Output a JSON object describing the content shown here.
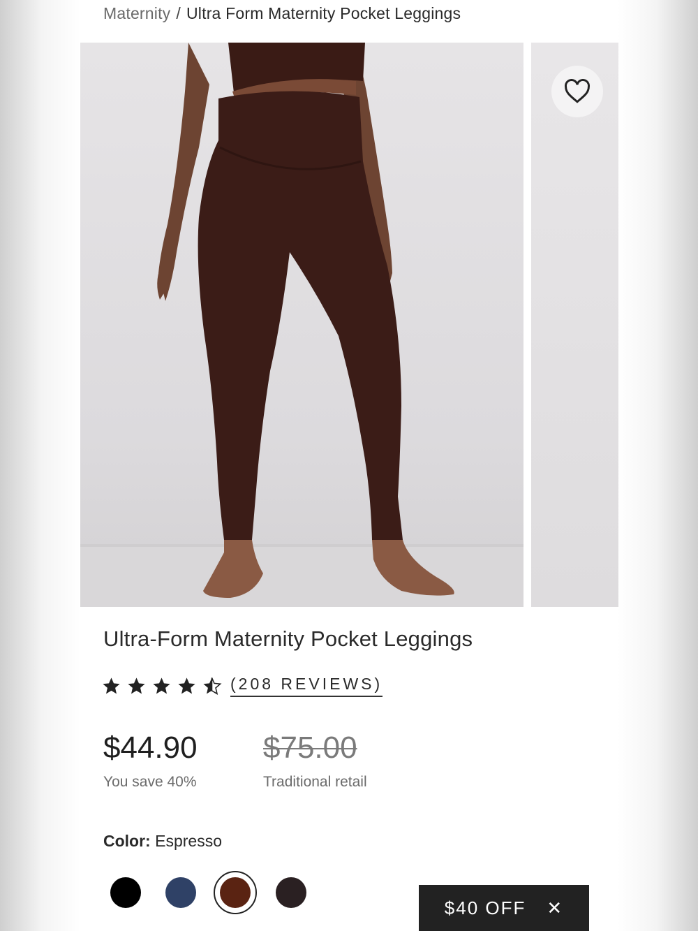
{
  "breadcrumb": {
    "parent": "Maternity",
    "separator": "/",
    "current": "Ultra Form Maternity Pocket Leggings"
  },
  "gallery": {
    "main_photo": "leggings-model-photo",
    "wishlist_icon": "heart-icon"
  },
  "product": {
    "title": "Ultra-Form Maternity Pocket Leggings",
    "rating": 4.5,
    "rating_max": 5,
    "reviews_label": "(208 REVIEWS)",
    "price": "$44.90",
    "savings": "You save 40%",
    "retail_price": "$75.00",
    "retail_label": "Traditional retail"
  },
  "color": {
    "label": "Color:",
    "selected": "Espresso",
    "swatches": [
      {
        "name": "black",
        "hex": "#000000"
      },
      {
        "name": "navy",
        "hex": "#2f4166"
      },
      {
        "name": "espresso",
        "hex": "#5a2312",
        "selected": true
      },
      {
        "name": "charcoal",
        "hex": "#2a2022"
      }
    ]
  },
  "promo": {
    "label": "$40 OFF",
    "close_icon": "close-icon"
  }
}
